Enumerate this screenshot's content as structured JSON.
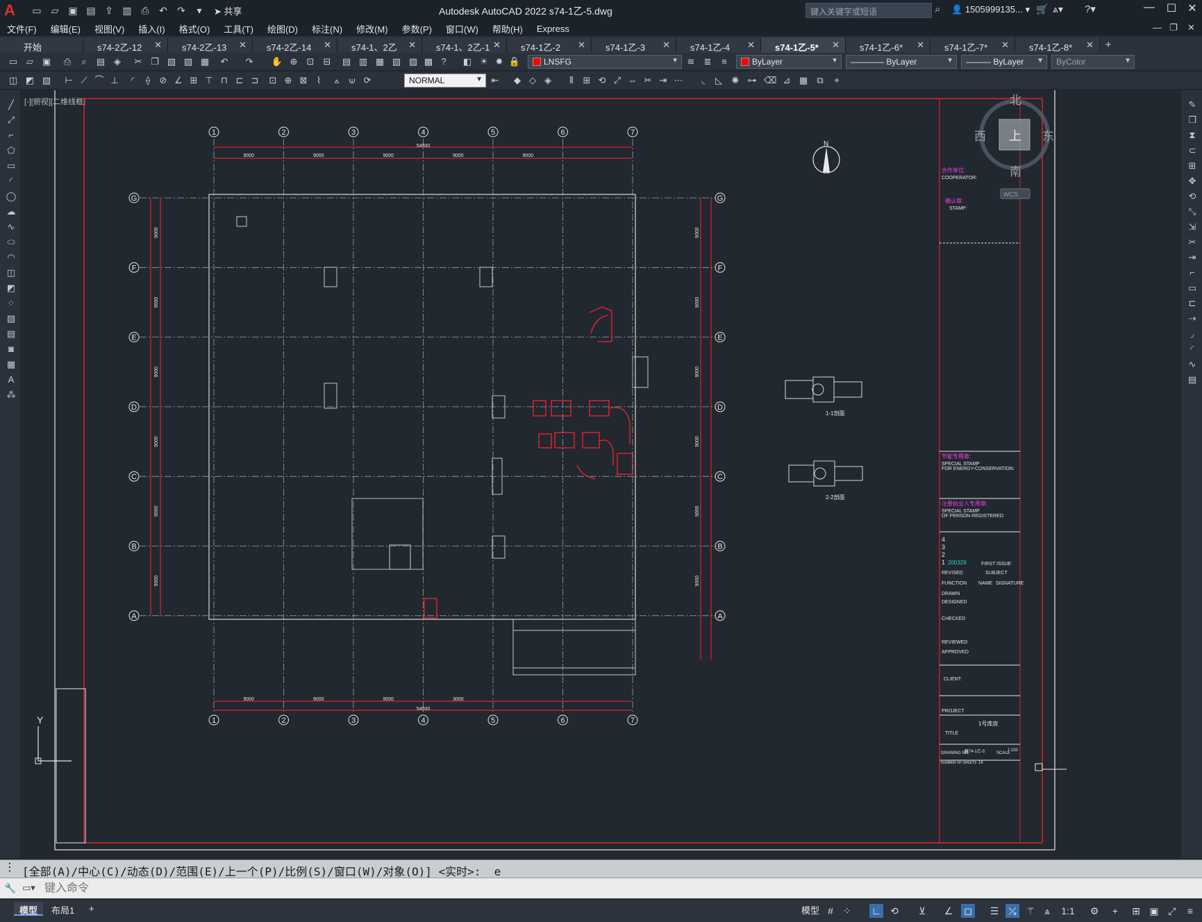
{
  "titlebar": {
    "app_title": "Autodesk AutoCAD 2022    s74-1乙-5.dwg",
    "share_label": "共享",
    "search_placeholder": "键入关键字或短语",
    "user_name": "1505999135...",
    "window_controls": [
      "minimize-icon",
      "restore-icon",
      "close-icon"
    ]
  },
  "menubar": {
    "items": [
      "文件(F)",
      "编辑(E)",
      "视图(V)",
      "插入(I)",
      "格式(O)",
      "工具(T)",
      "绘图(D)",
      "标注(N)",
      "修改(M)",
      "参数(P)",
      "窗口(W)",
      "帮助(H)",
      "Express"
    ]
  },
  "file_tabs": {
    "tabs": [
      "开始",
      "s74-2乙-12",
      "s74-2乙-13",
      "s74-2乙-14",
      "s74-1、2乙",
      "s74-1、2乙-1",
      "s74-1乙-2",
      "s74-1乙-3",
      "s74-1乙-4",
      "s74-1乙-5*",
      "s74-1乙-6*",
      "s74-1乙-7*",
      "s74-1乙-8*"
    ],
    "active_index": 9
  },
  "properties": {
    "layer": "LNSFG",
    "color": "ByLayer",
    "linetype": "ByLayer",
    "lineweight": "ByLayer",
    "plotstyle": "ByColor",
    "dimstyle": "NORMAL"
  },
  "viewport": {
    "label": "[-][俯视][二维线框]",
    "viewcube": {
      "north": "北",
      "south": "南",
      "east": "东",
      "west": "西",
      "top": "上",
      "wcs": "WCS"
    },
    "grid_columns": [
      "1",
      "2",
      "3",
      "4",
      "5",
      "6",
      "7"
    ],
    "grid_rows": [
      "G",
      "F",
      "E",
      "D",
      "C",
      "B",
      "A"
    ],
    "top_dims": [
      "9000",
      "9000",
      "9000",
      "9000",
      "9000"
    ],
    "total_dim": "54000",
    "bottom_dims": [
      "9000",
      "9000",
      "9000",
      "3000"
    ],
    "side_dims": [
      "9000",
      "9000",
      "9000",
      "9000",
      "9000",
      "9000"
    ],
    "north_label": "N",
    "section_titles": [
      "1-1剖面",
      "2-2剖面"
    ],
    "title_block": {
      "cooperator_cn": "合作单位:",
      "cooperator": "COOPERATOR:",
      "stamp_cn": "确认章:",
      "stamp": "STAMP:",
      "energy_cn": "节能专用章:",
      "energy1": "SPECIAL STAMP",
      "energy2": "FOR ENERGY-CONSERVATION:",
      "registered_cn": "注册执业人专用章:",
      "registered1": "SPECIAL STAMP",
      "registered2": "OF PERSON REGISTERED:",
      "rev_numbers": [
        "4",
        "3",
        "2",
        "1"
      ],
      "rev_date": "200329",
      "first_issue": "FIRST ISSUE",
      "revised": "REVISED",
      "subject": "SUBJECT",
      "function": "FUNCTION",
      "name": "NAME",
      "signature": "SIGNATURE",
      "drawn": "DRAWN",
      "designed": "DESIGNED",
      "checked": "CHECKED",
      "reviewed": "REVIEWED",
      "approved": "APPROVED",
      "client": "CLIENT:",
      "project": "PROJECT",
      "title": "TITLE",
      "title_text": "1号库房",
      "drawing_no": "DRAWING NO.",
      "drawing_no_value": "暖74-1乙-5",
      "scale": "SCALE",
      "scale_value": "1:150",
      "sheets": "NUMBER OF SHEETS",
      "sheets_value": "14"
    },
    "ucs": {
      "y": "Y"
    }
  },
  "command": {
    "history": "[全部(A)/中心(C)/动态(D)/范围(E)/上一个(P)/比例(S)/窗口(W)/对象(O)] <实时>: _e",
    "placeholder": "键入命令"
  },
  "status": {
    "layout_tabs": [
      "模型",
      "布局1"
    ],
    "model_label": "模型",
    "scale": "1:1"
  }
}
